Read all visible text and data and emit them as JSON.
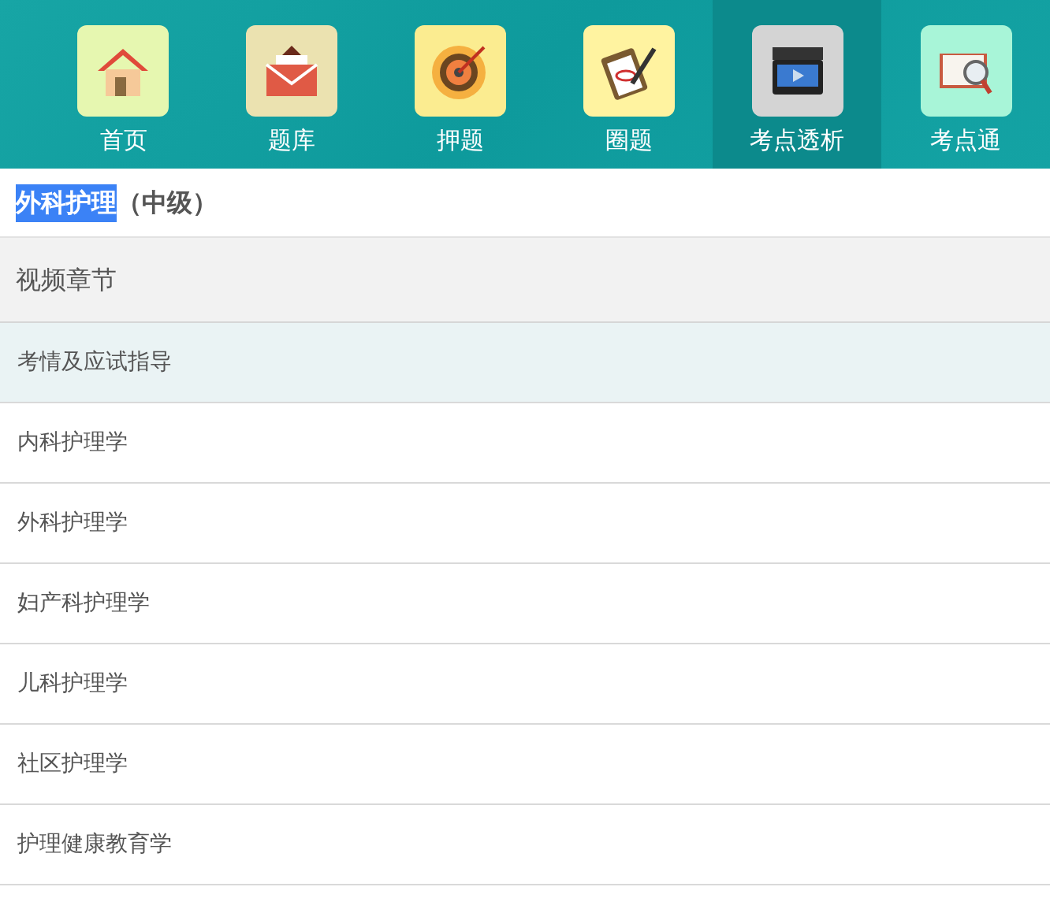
{
  "nav": [
    {
      "label": "首页",
      "kind": "home",
      "selected": false
    },
    {
      "label": "题库",
      "kind": "mail",
      "selected": false
    },
    {
      "label": "押题",
      "kind": "target",
      "selected": false
    },
    {
      "label": "圈题",
      "kind": "clipboard",
      "selected": false
    },
    {
      "label": "考点透析",
      "kind": "video",
      "selected": true
    },
    {
      "label": "考点通",
      "kind": "book",
      "selected": false
    }
  ],
  "title": {
    "main": "外科护理",
    "main_text_selected": true,
    "suffix": "（中级）"
  },
  "section": {
    "title": "视频章节"
  },
  "chapters": [
    {
      "label": "考情及应试指导",
      "selected": true
    },
    {
      "label": "内科护理学",
      "selected": false
    },
    {
      "label": "外科护理学",
      "selected": false
    },
    {
      "label": "妇产科护理学",
      "selected": false
    },
    {
      "label": "儿科护理学",
      "selected": false
    },
    {
      "label": "社区护理学",
      "selected": false
    },
    {
      "label": "护理健康教育学",
      "selected": false
    }
  ]
}
